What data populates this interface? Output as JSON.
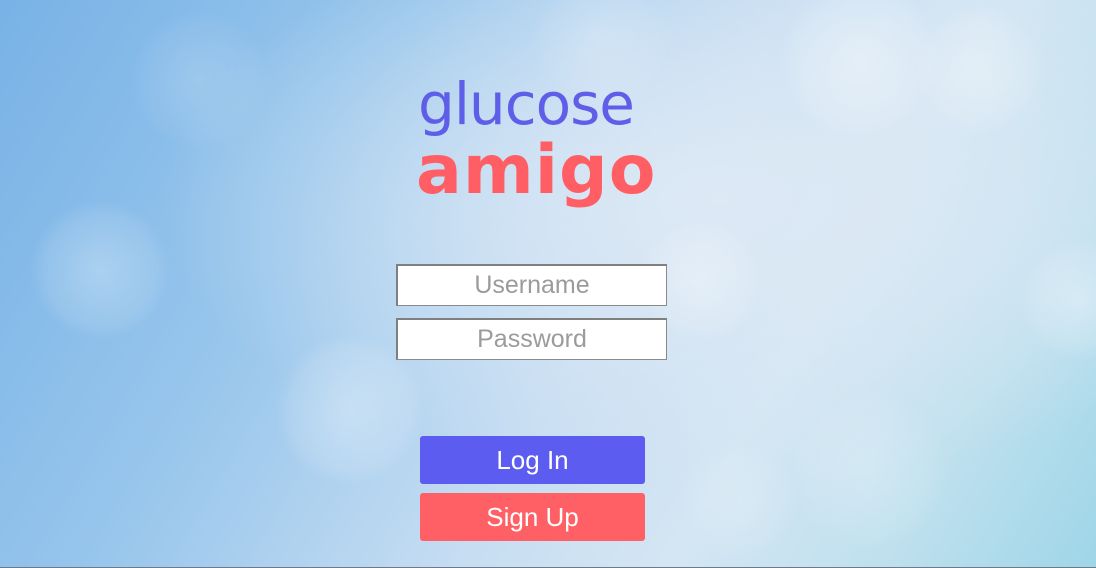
{
  "logo": {
    "line1": "glucose",
    "line2": "amigo"
  },
  "form": {
    "username_placeholder": "Username",
    "username_value": "",
    "password_placeholder": "Password",
    "password_value": ""
  },
  "buttons": {
    "login_label": "Log In",
    "signup_label": "Sign Up"
  },
  "colors": {
    "brand_primary": "#5e5ee8",
    "brand_secondary": "#ff5f64",
    "login_button": "#5c5cf0",
    "signup_button": "#ff6066"
  }
}
